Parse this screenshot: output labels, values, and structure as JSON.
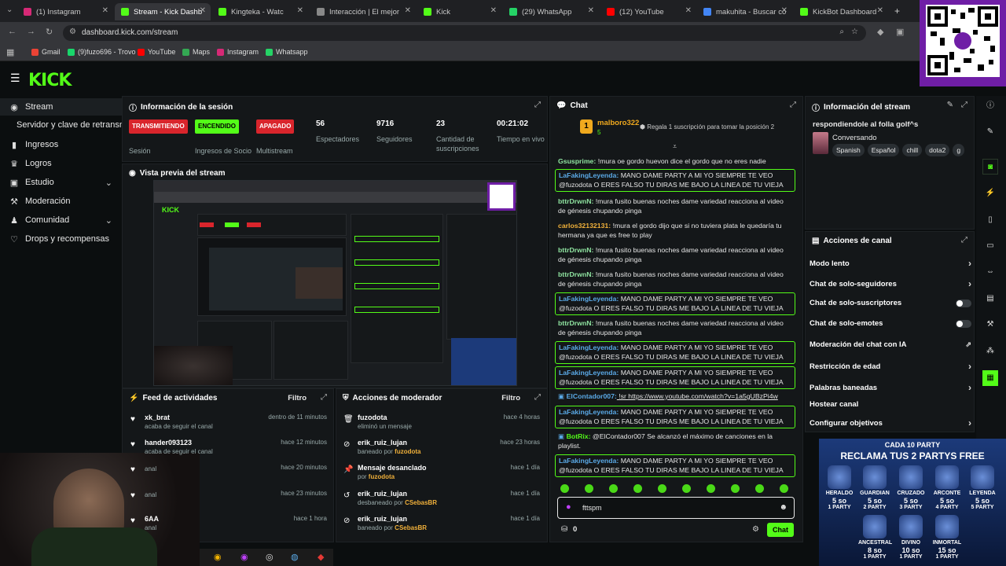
{
  "browser": {
    "tabs": [
      {
        "title": "(1) Instagram",
        "color": "#d62976"
      },
      {
        "title": "Stream - Kick Dashb",
        "color": "#53fc18"
      },
      {
        "title": "Kingteka - Watc",
        "color": "#53fc18"
      },
      {
        "title": "Interacción | El mejor",
        "color": "#888888"
      },
      {
        "title": "Kick",
        "color": "#53fc18"
      },
      {
        "title": "(29) WhatsApp",
        "color": "#25d366"
      },
      {
        "title": "(12) YouTube",
        "color": "#ff0000"
      },
      {
        "title": "makuhita - Buscar co",
        "color": "#4285f4"
      },
      {
        "title": "KickBot Dashboard",
        "color": "#53fc18"
      }
    ],
    "url": "dashboard.kick.com/stream",
    "bookmarks": [
      {
        "label": "Gmail",
        "color": "#ea4335"
      },
      {
        "label": "(9)fuzo696 - Trovo",
        "color": "#19d66b"
      },
      {
        "label": "YouTube",
        "color": "#ff0000"
      },
      {
        "label": "Maps",
        "color": "#34a853"
      },
      {
        "label": "Instagram",
        "color": "#d62976"
      },
      {
        "label": "Whatsapp",
        "color": "#25d366"
      }
    ]
  },
  "brand": {
    "logo": "KICK",
    "accent": "#53fc18"
  },
  "sidebar": {
    "items": [
      {
        "label": "Stream",
        "icon": "broadcast-icon"
      },
      {
        "label": "Servidor y clave de retransm",
        "icon": ""
      },
      {
        "label": "Ingresos",
        "icon": "money-icon"
      },
      {
        "label": "Logros",
        "icon": "trophy-icon"
      },
      {
        "label": "Estudio",
        "icon": "studio-icon"
      },
      {
        "label": "Moderación",
        "icon": "hammer-icon"
      },
      {
        "label": "Comunidad",
        "icon": "community-icon"
      },
      {
        "label": "Drops y recompensas",
        "icon": "gift-icon"
      }
    ]
  },
  "session": {
    "title": "Información de la sesión",
    "stats": [
      {
        "value": "TRANSMITIENDO",
        "label": "Sesión",
        "type": "badge",
        "color": "#d9252c"
      },
      {
        "value": "ENCENDIDO",
        "label": "Ingresos de Socio",
        "type": "badge",
        "color": "#53fc18"
      },
      {
        "value": "APAGADO",
        "label": "Multistream",
        "type": "badge",
        "color": "#d9252c"
      },
      {
        "value": "56",
        "label": "Espectadores",
        "type": "num"
      },
      {
        "value": "9716",
        "label": "Seguidores",
        "type": "num"
      },
      {
        "value": "23",
        "label": "Cantidad de suscripciones",
        "type": "num"
      },
      {
        "value": "00:21:02",
        "label": "Tiempo en vivo",
        "type": "num"
      }
    ]
  },
  "preview": {
    "title": "Vista previa del stream"
  },
  "feed": {
    "title": "Feed de actividades",
    "filter": "Filtro",
    "items": [
      {
        "name": "xk_brat",
        "sub": "acaba de seguir el canal",
        "time": "dentro de 11 minutos"
      },
      {
        "name": "hander093123",
        "sub": "acaba de seguir el canal",
        "time": "hace 12 minutos"
      },
      {
        "name": "",
        "sub": "anal",
        "time": "hace 20 minutos"
      },
      {
        "name": "",
        "sub": "anal",
        "time": "hace 23 minutos"
      },
      {
        "name": "6AA",
        "sub": "anal",
        "time": "hace 1 hora"
      }
    ]
  },
  "modactions": {
    "title": "Acciones de moderador",
    "filter": "Filtro",
    "items": [
      {
        "name": "fuzodota",
        "sub": "eliminó un mensaje",
        "by": "",
        "time": "hace 4 horas"
      },
      {
        "name": "erik_ruiz_lujan",
        "sub": "baneado por",
        "by": "fuzodota",
        "time": "hace 23 horas"
      },
      {
        "name": "Mensaje desanclado",
        "sub": "por",
        "by": "fuzodota",
        "time": "hace 1 día"
      },
      {
        "name": "erik_ruiz_lujan",
        "sub": "desbaneado por",
        "by": "CSebasBR",
        "time": "hace 1 día"
      },
      {
        "name": "erik_ruiz_lujan",
        "sub": "baneado por",
        "by": "CSebasBR",
        "time": "hace 1 día"
      }
    ]
  },
  "chat": {
    "title": "Chat",
    "pinned": {
      "user": "malboro322",
      "count": "5",
      "text": "Regala 1 suscripción para tomar la posición 2"
    },
    "messages": [
      {
        "user": "Gsusprime:",
        "color": "#8fe3a0",
        "text": " !mura oe gordo huevon dice el gordo que no eres nadie",
        "box": false
      },
      {
        "user": "LaFakingLeyenda:",
        "color": "#5aa9e6",
        "text": " MANO DAME PARTY A MI YO SIEMPRE TE VEO @fuzodota O ERES FALSO TU DIRAS ME BAJO LA LINEA DE TU VIEJA",
        "box": true
      },
      {
        "user": "bttrDrwnN:",
        "color": "#8fe3a0",
        "text": " !mura fusito buenas noches dame variedad reacciona al video de génesis chupando pinga",
        "box": false
      },
      {
        "user": "carlos32132131:",
        "color": "#f0b03a",
        "text": " !mura el gordo dijo que si no tuviera plata le quedaría tu hermana ya que es free to play",
        "box": false
      },
      {
        "user": "bttrDrwnN:",
        "color": "#8fe3a0",
        "text": " !mura fusito buenas noches dame variedad reacciona al video de génesis chupando pinga",
        "box": false
      },
      {
        "user": "bttrDrwnN:",
        "color": "#8fe3a0",
        "text": " !mura fusito buenas noches dame variedad reacciona al video de génesis chupando pinga",
        "box": false
      },
      {
        "user": "LaFakingLeyenda:",
        "color": "#5aa9e6",
        "text": " MANO DAME PARTY A MI YO SIEMPRE TE VEO @fuzodota O ERES FALSO TU DIRAS ME BAJO LA LINEA DE TU VIEJA",
        "box": true
      },
      {
        "user": "bttrDrwnN:",
        "color": "#8fe3a0",
        "text": " !mura fusito buenas noches dame variedad reacciona al video de génesis chupando pinga",
        "box": false
      },
      {
        "user": "LaFakingLeyenda:",
        "color": "#5aa9e6",
        "text": " MANO DAME PARTY A MI YO SIEMPRE TE VEO @fuzodota O ERES FALSO TU DIRAS ME BAJO LA LINEA DE TU VIEJA",
        "box": true
      },
      {
        "user": "LaFakingLeyenda:",
        "color": "#5aa9e6",
        "text": " MANO DAME PARTY A MI YO SIEMPRE TE VEO @fuzodota O ERES FALSO TU DIRAS ME BAJO LA LINEA DE TU VIEJA",
        "box": true
      },
      {
        "user": "ElContador007:",
        "color": "#5aa9e6",
        "text": " !sr https://www.youtube.com/watch?v=1a5gUBzPi4w",
        "box": false
      },
      {
        "user": "LaFakingLeyenda:",
        "color": "#5aa9e6",
        "text": " MANO DAME PARTY A MI YO SIEMPRE TE VEO @fuzodota O ERES FALSO TU DIRAS ME BAJO LA LINEA DE TU VIEJA",
        "box": true
      },
      {
        "user": "BotRix:",
        "color": "#53fc18",
        "text": " @ElContador007 Se alcanzó el máximo de canciones en la playlist.",
        "box": false
      },
      {
        "user": "LaFakingLeyenda:",
        "color": "#5aa9e6",
        "text": " MANO DAME PARTY A MI YO SIEMPRE TE VEO @fuzodota O ERES FALSO TU DIRAS ME BAJO LA LINEA DE TU VIEJA",
        "box": true
      }
    ],
    "input_value": "fttspm",
    "counter": "0",
    "send_label": "Chat"
  },
  "streaminfo": {
    "title": "Información del stream",
    "stream_title": "respondiendole al folla golf^s",
    "category": "Conversando",
    "tags": [
      "Spanish",
      "Español",
      "chill",
      "dota2",
      "g"
    ]
  },
  "channel": {
    "title": "Acciones de canal",
    "items": [
      {
        "label": "Modo lento",
        "control": "chevron"
      },
      {
        "label": "Chat de solo-seguidores",
        "control": "chevron"
      },
      {
        "label": "Chat de solo-suscriptores",
        "control": "toggle"
      },
      {
        "label": "Chat de solo-emotes",
        "control": "toggle"
      },
      {
        "label": "Moderación del chat con IA",
        "control": "external"
      },
      {
        "label": "Restricción de edad",
        "control": "chevron"
      },
      {
        "label": "Palabras baneadas",
        "control": "chevron"
      },
      {
        "label": "Hostear canal",
        "control": "none"
      },
      {
        "label": "Configurar objetivos",
        "control": "chevron"
      }
    ]
  },
  "promo": {
    "top": "CADA 10 PARTY",
    "headline": "RECLAMA TUS 2 PARTYS FREE",
    "ranks": [
      {
        "name": "HERALDO",
        "price": "5 so",
        "party": "1 PARTY"
      },
      {
        "name": "GUARDIAN",
        "price": "5 so",
        "party": "2 PARTY"
      },
      {
        "name": "CRUZADO",
        "price": "5 so",
        "party": "3 PARTY"
      },
      {
        "name": "ARCONTE",
        "price": "5 so",
        "party": "4 PARTY"
      },
      {
        "name": "LEYENDA",
        "price": "5 so",
        "party": "5 PARTY"
      },
      {
        "name": "ANCESTRAL",
        "price": "8 so",
        "party": "1 PARTY"
      },
      {
        "name": "DIVINO",
        "price": "10 so",
        "party": "1 PARTY"
      },
      {
        "name": "INMORTAL",
        "price": "15 so",
        "party": "1 PARTY"
      }
    ]
  }
}
